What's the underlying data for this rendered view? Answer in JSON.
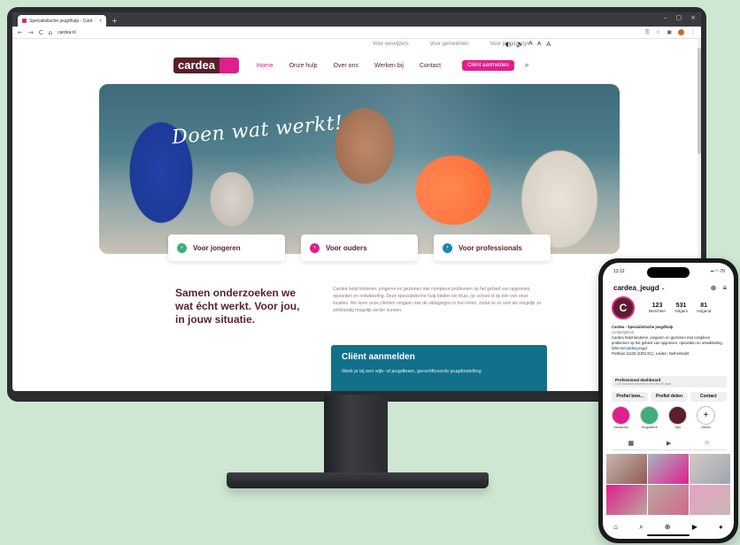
{
  "browser": {
    "tab_title": "Specialistische jeugdhulp - Card",
    "tab_close": "×",
    "new_tab": "+",
    "window_controls": [
      "–",
      "▢",
      "×"
    ],
    "nav_buttons": [
      "←",
      "→",
      "C",
      "⌂"
    ],
    "url": "cardea.nl",
    "toolbar_icons": [
      "⎘",
      "☆",
      "▣",
      "⋮"
    ]
  },
  "site": {
    "top_links": [
      "Voor verwijzers",
      "Voor gemeenten",
      "Voor jeugdzorg/es"
    ],
    "top_tools": [
      "◐",
      "🔈",
      "A",
      "A",
      "A"
    ],
    "logo": "cardea",
    "menu": [
      "Home",
      "Onze hulp",
      "Over ons",
      "Werken bij",
      "Contact"
    ],
    "cta": "Cliënt aanmelden",
    "search_icon": "⌕",
    "hero_title": "Doen wat werkt!",
    "cards": [
      {
        "label": "Voor jongeren",
        "color": "#3fae7a"
      },
      {
        "label": "Voor ouders",
        "color": "#e01f8d"
      },
      {
        "label": "Voor professionals",
        "color": "#1a86b0"
      }
    ],
    "card_arrow": "›",
    "intro": "Samen onderzoeken we wat écht werkt. Voor jou, in jouw situatie.",
    "body": "Cardea helpt kinderen, jongeren en gezinnen met complexe problemen op het gebied van opgroeien, opvoeden en ontwikkeling. Deze specialistische hulp bieden we thuis, op school of op één van onze locaties. We leren onze cliënten omgaan met de uitdagingen in hun leven, zodat ze zo snel als mogelijk zo zelfstandig mogelijk verder kunnen.",
    "client_title": "Cliënt aanmelden",
    "client_sub": "Werk je bij een wijk- of jeugdteam, gecertificeerde jeugdinstelling"
  },
  "phone": {
    "time": "13:12",
    "signal": "▪▪ ◠ 70",
    "username": "cardea_jeugd",
    "chevron": "⌄",
    "head_icons": [
      "⊕",
      "≡"
    ],
    "avatar_letter": "C",
    "stats": [
      {
        "n": "123",
        "l": "Berichten"
      },
      {
        "n": "531",
        "l": "Volgers"
      },
      {
        "n": "81",
        "l": "Volgend"
      }
    ],
    "bio_name": "Cardea - Specialistische jeugdhulp",
    "bio_category": "Liefdadigheid",
    "bio_text": "Cardea helpt kinderen, jongeren en gezinnen met complexe problemen op het gebied van opgroeien, opvoeden en ontwikkeling.",
    "bio_link": "linktr.ee/cardea.jeugd",
    "bio_address": "Postbus 11126 (2301 EC), Leiden, Netherlands",
    "dashboard_title": "Professional dashboard",
    "dashboard_sub": "1,1K account reached in the last 30 days",
    "buttons": [
      "Profiel bew...",
      "Profiel delen",
      "Contact"
    ],
    "highlights": [
      {
        "label": "Vacatures",
        "color": "#e01f8d"
      },
      {
        "label": "Jeugdwerk",
        "color": "#3fae7a"
      },
      {
        "label": "Tips",
        "color": "#5a1f2b"
      },
      {
        "label": "Nieuw",
        "color": "#ffffff"
      }
    ],
    "new_highlight_icon": "+",
    "tab_icons": [
      "▦",
      "▶",
      "☺"
    ],
    "tile_colors": [
      "#c8b7b3",
      "#e01f8d",
      "#a9b5c0",
      "#d7c9c4",
      "#8f5a52",
      "#e8a0c6",
      "#b9a89e",
      "#d06a8e",
      "#9aa6b0"
    ],
    "bottom_icons": [
      "⌂",
      "⌕",
      "⊕",
      "▶",
      "●"
    ]
  }
}
